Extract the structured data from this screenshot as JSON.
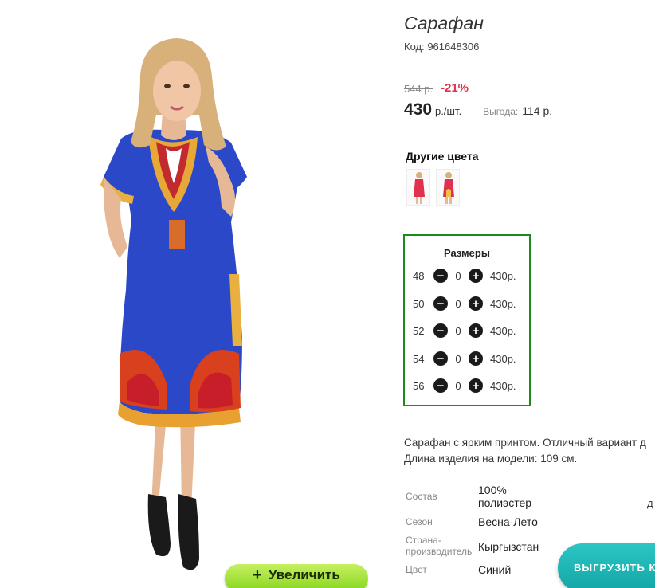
{
  "product": {
    "title": "Сарафан",
    "code": "Код: 961648306",
    "old_price": "544 р.",
    "discount": "-21%",
    "price": "430",
    "price_unit": "р./шт.",
    "benefit_label": "Выгода:",
    "benefit_value": "114 р."
  },
  "other_colors": {
    "title": "Другие цвета",
    "swatch_colors": [
      "#e0324f",
      "#e0324f"
    ]
  },
  "sizes": {
    "title": "Размеры",
    "rows": [
      {
        "size": "48",
        "qty": "0",
        "price": "430р."
      },
      {
        "size": "50",
        "qty": "0",
        "price": "430р."
      },
      {
        "size": "52",
        "qty": "0",
        "price": "430р."
      },
      {
        "size": "54",
        "qty": "0",
        "price": "430р."
      },
      {
        "size": "56",
        "qty": "0",
        "price": "430р."
      }
    ],
    "minus_icon": "minus-circle-icon",
    "plus_icon": "plus-circle-icon",
    "border_color": "#1e8a1e"
  },
  "description": {
    "line1": "Сарафан с ярким принтом. Отличный вариант д",
    "line2": "Длина изделия на модели: 109 см."
  },
  "properties": {
    "composition_label": "Состав",
    "composition_value_1": "100%",
    "composition_value_2": "полиэстер",
    "composition_extra": "д",
    "season_label": "Сезон",
    "season_value": "Весна-Лето",
    "country_label_1": "Страна-",
    "country_label_2": "производитель",
    "country_value": "Кыргызстан",
    "color_label": "Цвет",
    "color_value": "Синий"
  },
  "buttons": {
    "zoom_label": "Увеличить",
    "zoom_icon": "plus-icon",
    "export_label": "ВЫГРУЗИТЬ К"
  },
  "colors": {
    "dress_blue": "#2a48c8",
    "discount_red": "#e0304f",
    "zoom_green": "#84d41c",
    "export_teal": "#13a5a5"
  }
}
